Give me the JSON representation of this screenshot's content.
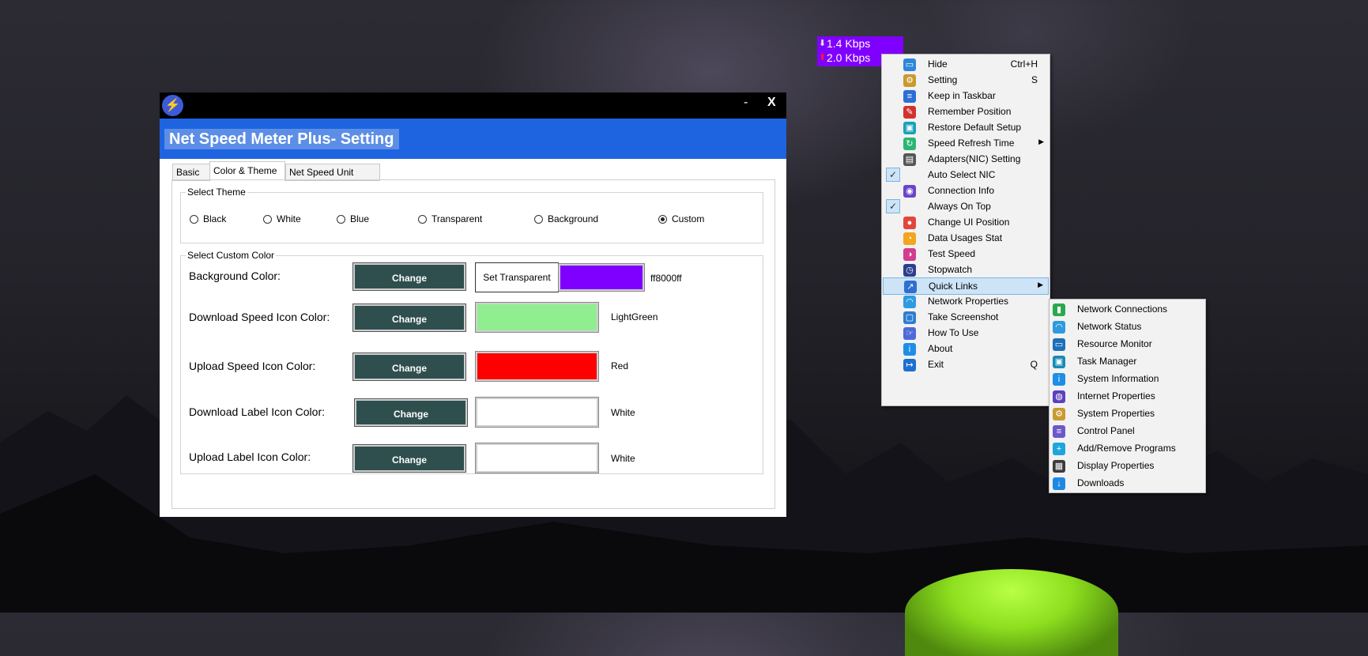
{
  "speed_widget": {
    "download": "1.4 Kbps",
    "upload": "2.0 Kbps",
    "bg_color": "#8000ff"
  },
  "settings_window": {
    "minimize": "-",
    "close": "X",
    "title": "Net Speed Meter Plus- Setting",
    "tabs": [
      "Basic",
      "Color & Theme",
      "Net Speed Unit"
    ],
    "active_tab": "Color & Theme",
    "theme_group": {
      "label": "Select Theme",
      "options": [
        "Black",
        "White",
        "Blue",
        "Transparent",
        "Background",
        "Custom"
      ],
      "selected": "Custom"
    },
    "custom_color_group": {
      "label": "Select Custom Color",
      "change_label": "Change",
      "set_transparent_label": "Set Transparent",
      "rows": [
        {
          "label": "Background Color:",
          "color": "#8000ff",
          "value": "ff8000ff"
        },
        {
          "label": "Download Speed Icon Color:",
          "color": "#90ee90",
          "value": "LightGreen"
        },
        {
          "label": "Upload Speed Icon Color:",
          "color": "#ff0000",
          "value": "Red"
        },
        {
          "label": "Download Label Icon Color:",
          "color": "#ffffff",
          "value": "White"
        },
        {
          "label": "Upload Label Icon Color:",
          "color": "#ffffff",
          "value": "White"
        }
      ]
    }
  },
  "context_menu": {
    "items": [
      {
        "label": "Hide",
        "shortcut": "Ctrl+H",
        "icon": "hide-icon"
      },
      {
        "label": "Setting",
        "shortcut": "S",
        "icon": "gear-icon"
      },
      {
        "label": "Keep in Taskbar",
        "icon": "taskbar-icon"
      },
      {
        "label": "Remember Position",
        "icon": "pin-icon"
      },
      {
        "label": "Restore Default Setup",
        "icon": "restore-icon"
      },
      {
        "label": "Speed Refresh Time",
        "icon": "refresh-icon",
        "submenu": true
      },
      {
        "label": "Adapters(NIC) Setting",
        "icon": "adapter-icon"
      },
      {
        "label": "Auto Select NIC",
        "checked": true
      },
      {
        "label": "Connection Info",
        "icon": "connection-info-icon"
      },
      {
        "label": "Always On Top",
        "checked": true
      },
      {
        "label": "Change UI Position",
        "icon": "location-icon"
      },
      {
        "label": "Data Usages Stat",
        "icon": "pie-chart-icon"
      },
      {
        "label": "Test Speed",
        "icon": "speedometer-icon"
      },
      {
        "label": "Stopwatch",
        "icon": "stopwatch-icon"
      },
      {
        "label": "Quick Links",
        "icon": "share-icon",
        "submenu": true,
        "highlighted": true
      },
      {
        "label": "Network Properties",
        "icon": "wifi-icon"
      },
      {
        "label": "Take Screenshot",
        "icon": "screenshot-icon"
      },
      {
        "label": "How To Use",
        "icon": "hand-pointer-icon"
      },
      {
        "label": "About",
        "icon": "info-icon"
      },
      {
        "label": "Exit",
        "shortcut": "Q",
        "icon": "exit-icon"
      }
    ]
  },
  "quick_links_submenu": {
    "items": [
      {
        "label": "Network Connections",
        "icon": "bar-chart-icon"
      },
      {
        "label": "Network Status",
        "icon": "wifi-icon"
      },
      {
        "label": "Resource Monitor",
        "icon": "monitor-icon"
      },
      {
        "label": "Task Manager",
        "icon": "task-manager-icon"
      },
      {
        "label": "System Information",
        "icon": "info-icon"
      },
      {
        "label": "Internet Properties",
        "icon": "globe-icon"
      },
      {
        "label": "System Properties",
        "icon": "gear-icon"
      },
      {
        "label": "Control Panel",
        "icon": "sliders-icon"
      },
      {
        "label": "Add/Remove Programs",
        "icon": "add-icon"
      },
      {
        "label": "Display Properties",
        "icon": "display-icon"
      },
      {
        "label": "Downloads",
        "icon": "download-icon"
      }
    ]
  }
}
